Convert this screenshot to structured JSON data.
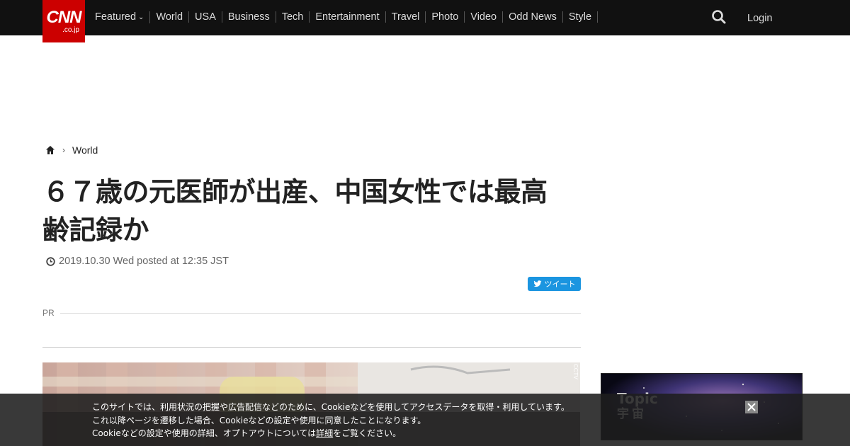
{
  "brand": {
    "logo_main": "CNN",
    "logo_sub": ".co.jp",
    "color": "#cc0000"
  },
  "nav": {
    "items": [
      {
        "label": "Featured",
        "has_dropdown": true
      },
      {
        "label": "World"
      },
      {
        "label": "USA"
      },
      {
        "label": "Business"
      },
      {
        "label": "Tech"
      },
      {
        "label": "Entertainment"
      },
      {
        "label": "Travel"
      },
      {
        "label": "Photo"
      },
      {
        "label": "Video"
      },
      {
        "label": "Odd News"
      },
      {
        "label": "Style"
      }
    ],
    "search_icon": "search-icon",
    "login_label": "Login"
  },
  "breadcrumb": {
    "home_icon": "home-icon",
    "section": "World"
  },
  "article": {
    "title_line1": "６７歳の元医師が出産、中国女性では最高",
    "title_line2": "齢記録か",
    "posted": "2019.10.30 Wed posted at 12:35 JST",
    "tweet_label": "ツイート",
    "pr_label": "PR",
    "image_credit": "CCTV"
  },
  "sidebar": {
    "topic_title": "Topic",
    "topic_sub": "宇宙"
  },
  "cookie": {
    "line1": "このサイトでは、利用状況の把握や広告配信などのために、Cookieなどを使用してアクセスデータを取得・利用しています。",
    "line2": "これ以降ページを遷移した場合、Cookieなどの設定や使用に同意したことになります。",
    "line3_pre": "Cookieなどの設定や使用の詳細、オプトアウトについては",
    "line3_link": "詳細",
    "line3_post": "をご覧ください。"
  },
  "colors": {
    "topbar": "#111111",
    "tweet": "#1b95e0"
  }
}
